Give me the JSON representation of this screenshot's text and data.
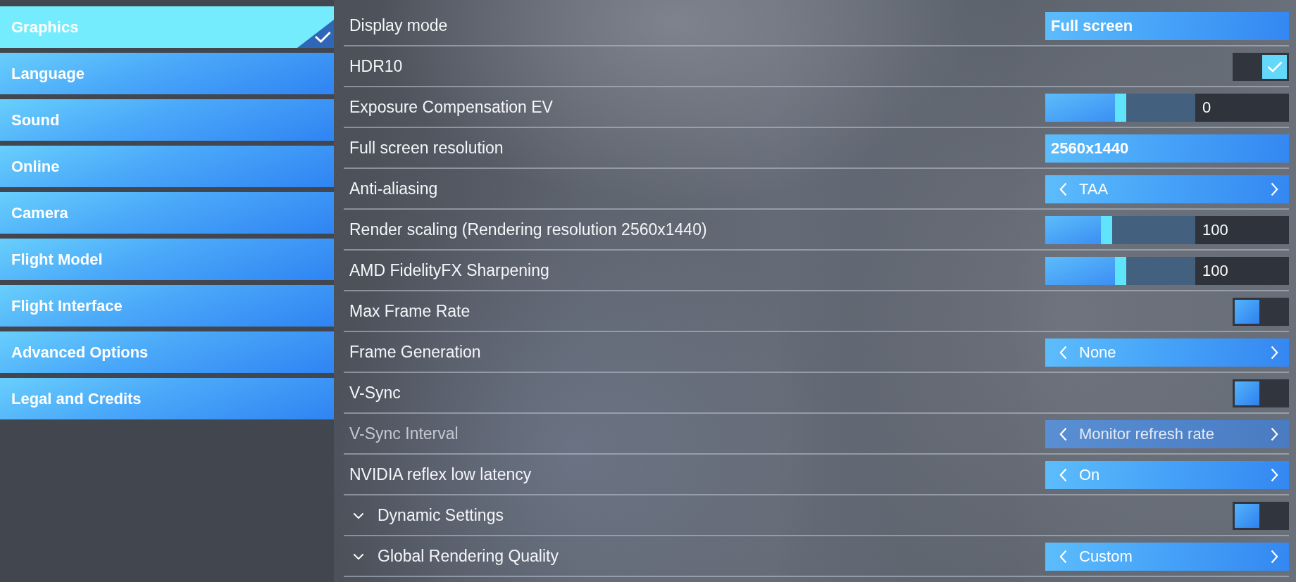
{
  "sidebar": {
    "items": [
      {
        "label": "Graphics",
        "selected": true
      },
      {
        "label": "Language",
        "selected": false
      },
      {
        "label": "Sound",
        "selected": false
      },
      {
        "label": "Online",
        "selected": false
      },
      {
        "label": "Camera",
        "selected": false
      },
      {
        "label": "Flight Model",
        "selected": false
      },
      {
        "label": "Flight Interface",
        "selected": false
      },
      {
        "label": "Advanced Options",
        "selected": false
      },
      {
        "label": "Legal and Credits",
        "selected": false
      }
    ]
  },
  "settings": [
    {
      "kind": "select",
      "label": "Display mode",
      "value": "Full screen",
      "disabled": false
    },
    {
      "kind": "toggle",
      "label": "HDR10",
      "on": true,
      "disabled": false
    },
    {
      "kind": "slider",
      "label": "Exposure Compensation EV",
      "level": 0.5,
      "reading": "0",
      "disabled": false
    },
    {
      "kind": "select",
      "label": "Full screen resolution",
      "value": "2560x1440",
      "disabled": false
    },
    {
      "kind": "stepper",
      "label": "Anti-aliasing",
      "value": "TAA",
      "disabled": false
    },
    {
      "kind": "slider",
      "label": "Render scaling (Rendering resolution 2560x1440)",
      "level": 0.4,
      "reading": "100",
      "disabled": false
    },
    {
      "kind": "slider",
      "label": "AMD FidelityFX Sharpening",
      "level": 0.5,
      "reading": "100",
      "disabled": false
    },
    {
      "kind": "toggle",
      "label": "Max Frame Rate",
      "on": false,
      "disabled": false
    },
    {
      "kind": "stepper",
      "label": "Frame Generation",
      "value": "None",
      "disabled": false
    },
    {
      "kind": "toggle",
      "label": "V-Sync",
      "on": false,
      "disabled": false
    },
    {
      "kind": "stepper",
      "label": "V-Sync Interval",
      "value": "Monitor refresh rate",
      "disabled": true
    },
    {
      "kind": "stepper",
      "label": "NVIDIA reflex low latency",
      "value": "On",
      "disabled": false
    },
    {
      "kind": "toggle",
      "label": "Dynamic Settings",
      "on": false,
      "expanded": false,
      "disabled": false
    },
    {
      "kind": "stepper",
      "label": "Global Rendering Quality",
      "value": "Custom",
      "expanded": false,
      "disabled": false
    }
  ]
}
